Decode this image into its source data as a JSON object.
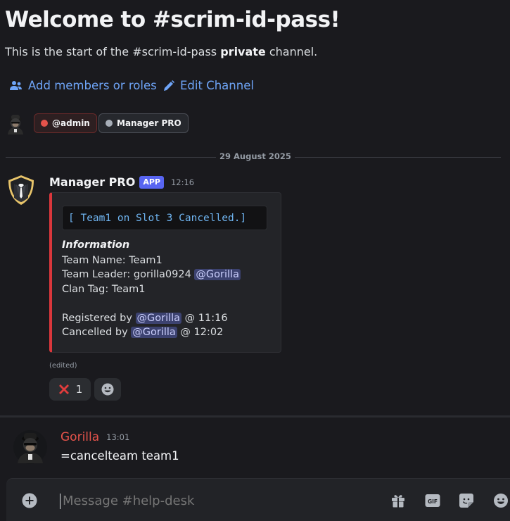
{
  "welcome": {
    "title": "Welcome to #scrim-id-pass!",
    "subtitle_pre": "This is the start of the #scrim-id-pass ",
    "subtitle_bold": "private",
    "subtitle_post": " channel.",
    "add_members_label": "Add members or roles",
    "edit_channel_label": "Edit Channel",
    "roles": [
      {
        "label": "@admin",
        "color": "#e5534b"
      },
      {
        "label": "Manager PRO",
        "color": "#a7aeb8"
      }
    ]
  },
  "date_divider": "29 August 2025",
  "bot_message": {
    "author": "Manager PRO",
    "badge": "APP",
    "time": "12:16",
    "embed": {
      "accent_color": "#da373c",
      "code_title": "[ Team1 on Slot 3 Cancelled.]",
      "field_title": "Information",
      "team_name": "Team Name: Team1",
      "team_leader_pre": "Team Leader: gorilla0924 ",
      "team_leader_mention": "@Gorilla",
      "clan_tag": "Clan Tag: Team1",
      "registered_pre": "Registered by ",
      "registered_mention": "@Gorilla",
      "registered_post": " @ 11:16",
      "cancelled_pre": "Cancelled by ",
      "cancelled_mention": "@Gorilla",
      "cancelled_post": " @ 12:02"
    },
    "edited": "(edited)",
    "reaction": {
      "emoji": "cross-mark",
      "count": "1"
    }
  },
  "user_message": {
    "author": "Gorilla",
    "author_color": "#e5534b",
    "time": "13:01",
    "text": "=cancelteam team1"
  },
  "composer": {
    "placeholder": "Message #help-desk",
    "icons": [
      "add-attachment-icon",
      "gift-icon",
      "gif-icon",
      "sticker-icon",
      "emoji-icon"
    ]
  }
}
